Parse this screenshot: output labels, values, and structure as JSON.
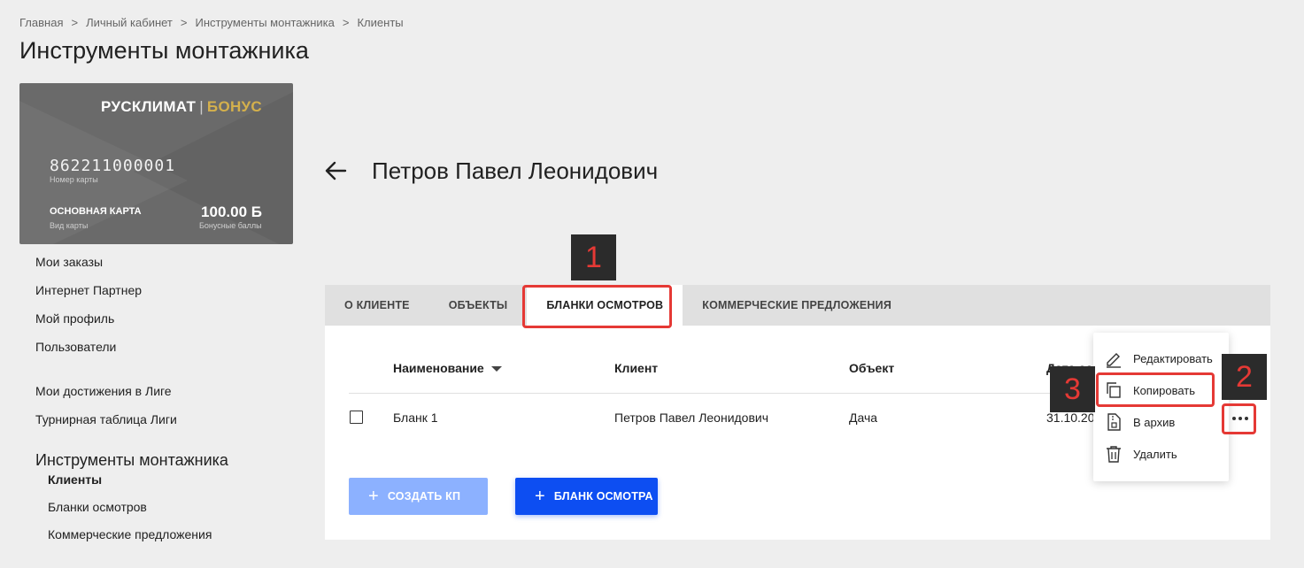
{
  "breadcrumb": [
    "Главная",
    "Личный кабинет",
    "Инструменты монтажника",
    "Клиенты"
  ],
  "breadcrumb_separator": ">",
  "page_title": "Инструменты монтажника",
  "card": {
    "brand_main": "РУСКЛИМАТ",
    "brand_sep": "|",
    "brand_accent": "БОНУС",
    "number": "862211000001",
    "number_label": "Номер карты",
    "type": "ОСНОВНАЯ КАРТА",
    "type_label": "Вид карты",
    "balance": "100.00 Б",
    "balance_label": "Бонусные баллы"
  },
  "nav": {
    "items": [
      "Мои заказы",
      "Интернет Партнер",
      "Мой профиль",
      "Пользователи"
    ],
    "league": [
      "Мои достижения в Лиге",
      "Турнирная таблица Лиги"
    ],
    "section_title": "Инструменты монтажника",
    "sub_items": [
      "Клиенты",
      "Бланки осмотров",
      "Коммерческие предложения"
    ],
    "active_sub": "Клиенты"
  },
  "client_name": "Петров Павел Леонидович",
  "tabs": [
    "О КЛИЕНТЕ",
    "ОБЪЕКТЫ",
    "БЛАНКИ ОСМОТРОВ",
    "КОММЕРЧЕСКИЕ ПРЕДЛОЖЕНИЯ"
  ],
  "active_tab": "БЛАНКИ ОСМОТРОВ",
  "table": {
    "headers": [
      "Наименование",
      "Клиент",
      "Объект",
      "Дата со"
    ],
    "rows": [
      {
        "name": "Бланк 1",
        "client": "Петров Павел Леонидович",
        "object": "Дача",
        "date": "31.10.20"
      }
    ]
  },
  "buttons": {
    "create_kp": "СОЗДАТЬ КП",
    "blank": "БЛАНК ОСМОТРА",
    "plus": "+"
  },
  "menu": {
    "items": [
      "Редактировать",
      "Копировать",
      "В архив",
      "Удалить"
    ]
  },
  "annotations": [
    "1",
    "2",
    "3"
  ],
  "colors": {
    "accent_blue": "#0d4ef2",
    "disabled_blue": "#8cb1ff",
    "annotation_red": "#e53935",
    "card_gold": "#d4b04c"
  }
}
